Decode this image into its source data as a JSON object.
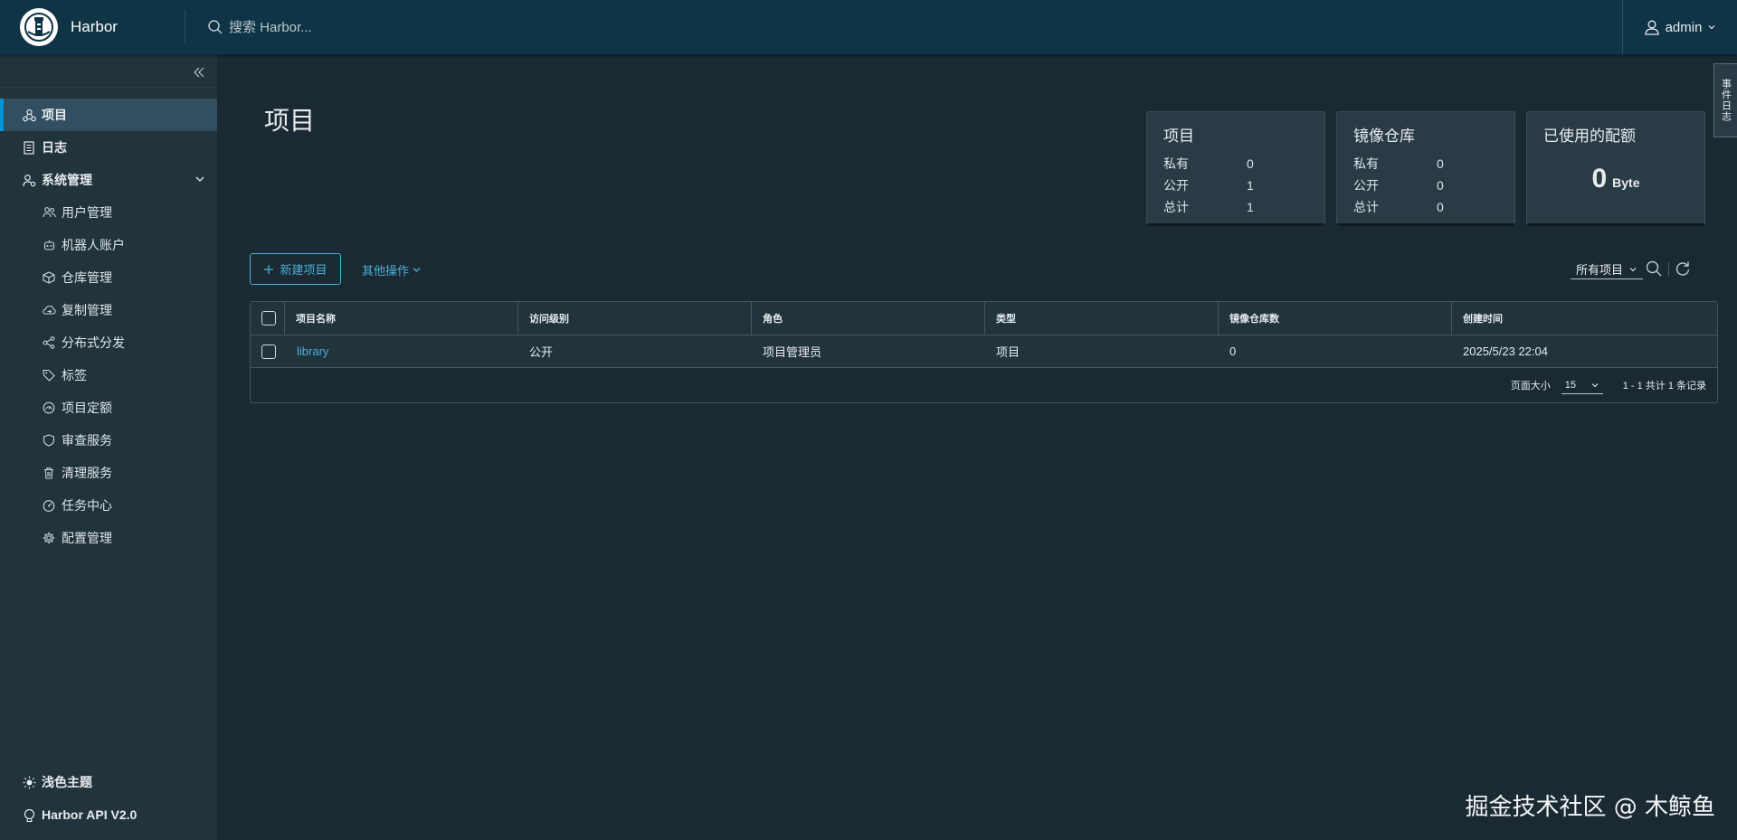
{
  "header": {
    "brand": "Harbor",
    "search_placeholder": "搜索 Harbor...",
    "user": "admin"
  },
  "sidebar": {
    "items": [
      {
        "label": "项目",
        "icon": "projects-icon",
        "active": true
      },
      {
        "label": "日志",
        "icon": "logs-icon"
      },
      {
        "label": "系统管理",
        "icon": "admin-icon"
      }
    ],
    "sub_items": [
      {
        "label": "用户管理",
        "icon": "users-icon"
      },
      {
        "label": "机器人账户",
        "icon": "robot-icon"
      },
      {
        "label": "仓库管理",
        "icon": "registry-icon"
      },
      {
        "label": "复制管理",
        "icon": "replication-icon"
      },
      {
        "label": "分布式分发",
        "icon": "distribution-icon"
      },
      {
        "label": "标签",
        "icon": "tag-icon"
      },
      {
        "label": "项目定额",
        "icon": "quota-icon"
      },
      {
        "label": "审查服务",
        "icon": "shield-icon"
      },
      {
        "label": "清理服务",
        "icon": "trash-icon"
      },
      {
        "label": "任务中心",
        "icon": "dashboard-icon"
      },
      {
        "label": "配置管理",
        "icon": "gear-icon"
      }
    ],
    "bottom": [
      {
        "label": "浅色主题",
        "icon": "sun-icon"
      },
      {
        "label": "Harbor API V2.0",
        "icon": "api-icon"
      }
    ]
  },
  "main": {
    "title": "项目",
    "cards": {
      "projects": {
        "title": "项目",
        "rows": [
          {
            "label": "私有",
            "value": "0"
          },
          {
            "label": "公开",
            "value": "1"
          },
          {
            "label": "总计",
            "value": "1"
          }
        ]
      },
      "repositories": {
        "title": "镜像仓库",
        "rows": [
          {
            "label": "私有",
            "value": "0"
          },
          {
            "label": "公开",
            "value": "0"
          },
          {
            "label": "总计",
            "value": "0"
          }
        ]
      },
      "quota": {
        "title": "已使用的配额",
        "value": "0",
        "unit": "Byte"
      }
    },
    "toolbar": {
      "new_project": "新建项目",
      "other_actions": "其他操作",
      "filter": "所有项目"
    },
    "table": {
      "columns": [
        "项目名称",
        "访问级别",
        "角色",
        "类型",
        "镜像仓库数",
        "创建时间"
      ],
      "rows": [
        {
          "name": "library",
          "access": "公开",
          "role": "项目管理员",
          "type": "项目",
          "repo_count": "0",
          "created": "2025/5/23 22:04"
        }
      ],
      "footer": {
        "page_size_label": "页面大小",
        "page_size": "15",
        "summary": "1 - 1 共计 1 条记录"
      }
    },
    "event_tab": "事件日志"
  },
  "watermark": "掘金技术社区 @ 木鲸鱼",
  "colors": {
    "header_bg": "#0f3445",
    "sidebar_bg": "#21333b",
    "main_bg": "#1b2a32",
    "accent": "#49afd9",
    "active_bg": "#324f62"
  }
}
